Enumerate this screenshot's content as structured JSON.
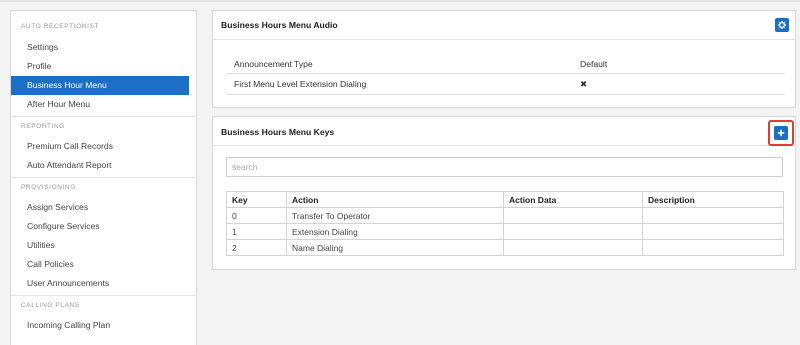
{
  "sidebar": {
    "sections": [
      {
        "label": "AUTO RECEPTIONIST"
      },
      {
        "label": "REPORTING"
      },
      {
        "label": "PROVISIONING"
      },
      {
        "label": "CALLING PLANS"
      }
    ],
    "items": [
      {
        "label": "Settings"
      },
      {
        "label": "Profile"
      },
      {
        "label": "Business Hour Menu",
        "active": true
      },
      {
        "label": "After Hour Menu"
      },
      {
        "label": "Premium Call Records"
      },
      {
        "label": "Auto Attendant Report"
      },
      {
        "label": "Assign Services"
      },
      {
        "label": "Configure Services"
      },
      {
        "label": "Utilities"
      },
      {
        "label": "Call Policies"
      },
      {
        "label": "User Announcements"
      },
      {
        "label": "Incoming Calling Plan"
      }
    ]
  },
  "audio_panel": {
    "title": "Business Hours Menu Audio",
    "action_icon": "gear-icon",
    "rows": [
      {
        "key": "Announcement Type",
        "value": "Default"
      },
      {
        "key": "First Menu Level Extension Dialing",
        "value": "✖"
      }
    ]
  },
  "keys_panel": {
    "title": "Business Hours Menu Keys",
    "action_icon": "plus-icon",
    "search_placeholder": "search",
    "columns": [
      "Key",
      "Action",
      "Action Data",
      "Description"
    ],
    "rows": [
      {
        "key": "0",
        "action": "Transfer To Operator",
        "action_data": "",
        "description": ""
      },
      {
        "key": "1",
        "action": "Extension Dialing",
        "action_data": "",
        "description": ""
      },
      {
        "key": "2",
        "action": "Name Dialing",
        "action_data": "",
        "description": ""
      }
    ]
  },
  "colors": {
    "accent": "#1c6fc6",
    "highlight": "#e23a3a",
    "background": "#f3f3f3"
  }
}
